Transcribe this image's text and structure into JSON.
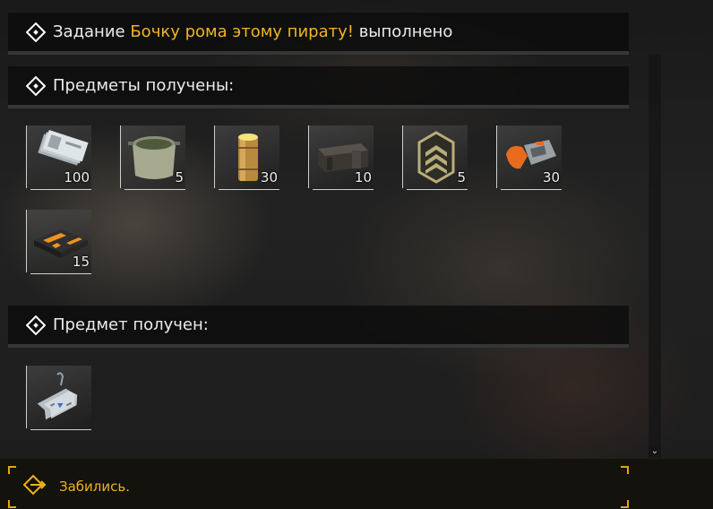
{
  "quest_header": {
    "prefix": "Задание",
    "quest_name": "Бочку рома этому пирату!",
    "suffix": "выполнено"
  },
  "items_header": {
    "title": "Предметы получены:"
  },
  "items": [
    {
      "icon": "banknotes-icon",
      "count": "100"
    },
    {
      "icon": "pot-icon",
      "count": "5"
    },
    {
      "icon": "battery-cell-icon",
      "count": "30"
    },
    {
      "icon": "ammo-crate-icon",
      "count": "10"
    },
    {
      "icon": "rank-chevron-icon",
      "count": "5"
    },
    {
      "icon": "orange-device-icon",
      "count": "30"
    },
    {
      "icon": "orange-crate-icon",
      "count": "15"
    }
  ],
  "single_header": {
    "title": "Предмет получен:"
  },
  "single_item": {
    "icon": "dog-tags-icon",
    "count": ""
  },
  "footer": {
    "reply_label": "Забились."
  },
  "colors": {
    "accent": "#f2b51d",
    "text": "#ececec",
    "header_bg": "#0c0c0c"
  }
}
